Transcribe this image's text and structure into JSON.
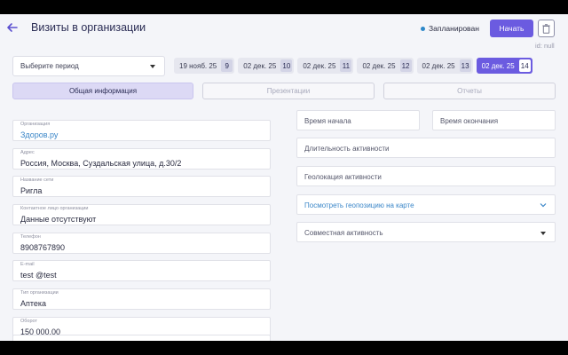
{
  "header": {
    "title": "Визиты в организации",
    "status": "Запланирован",
    "start_label": "Начать",
    "id_text": "id: null"
  },
  "colors": {
    "accent": "#6b5be0",
    "status_dot": "#2d88c9",
    "link": "#3a86c8"
  },
  "period": {
    "placeholder": "Выберите период"
  },
  "dates": [
    {
      "label": "19 нояб. 25",
      "num": "9",
      "active": false
    },
    {
      "label": "02 дек. 25",
      "num": "10",
      "active": false
    },
    {
      "label": "02 дек. 25",
      "num": "11",
      "active": false
    },
    {
      "label": "02 дек. 25",
      "num": "12",
      "active": false
    },
    {
      "label": "02 дек. 25",
      "num": "13",
      "active": false
    },
    {
      "label": "02 дек. 25",
      "num": "14",
      "active": true
    }
  ],
  "tabs": [
    "Общая информация",
    "Презентации",
    "Отчеты"
  ],
  "left_fields": [
    {
      "label": "Организация",
      "value": "Здоров.ру",
      "link": true
    },
    {
      "label": "Адрес",
      "value": "Россия, Москва, Суздальская улица, д.30/2",
      "link": false
    },
    {
      "label": "Название сети",
      "value": "Ригла",
      "link": false
    },
    {
      "label": "Контактное лицо организации",
      "value": "Данные отсутствуют",
      "link": false
    },
    {
      "label": "Телефон",
      "value": "8908767890",
      "link": false
    },
    {
      "label": "E-mail",
      "value": "test @test",
      "link": false
    },
    {
      "label": "Тип организации",
      "value": "Аптека",
      "link": false
    },
    {
      "label": "Оборот",
      "value": "150 000,00",
      "link": false
    }
  ],
  "right_fields": {
    "start_time": "Время начала",
    "end_time": "Время окончания",
    "duration": "Длительность активности",
    "geolocation": "Геолокация активности",
    "map_link": "Посмотреть геопозицию на карте",
    "joint_activity": "Совместная активность"
  }
}
